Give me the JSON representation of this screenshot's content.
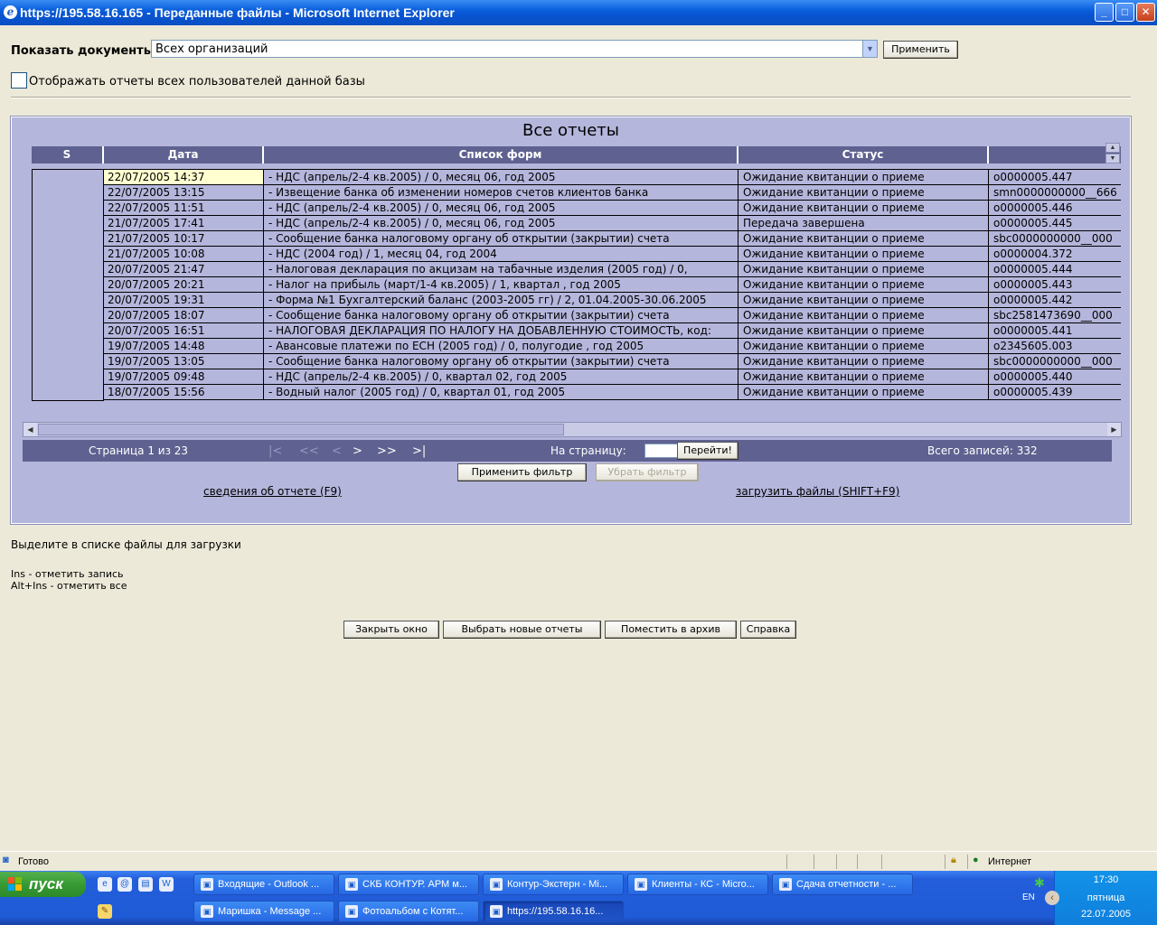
{
  "window": {
    "title": "https://195.58.16.165 - Переданные файлы - Microsoft Internet Explorer"
  },
  "filter": {
    "show_label": "Показать документы:",
    "org_value": "Всех организаций",
    "apply_label": "Применить",
    "all_users_label": "Отображать отчеты всех пользователей данной базы"
  },
  "panel": {
    "title": "Все отчеты",
    "columns": {
      "s": "S",
      "date": "Дата",
      "forms": "Список форм",
      "status": "Статус",
      "file": ""
    },
    "rows": [
      {
        "date": "22/07/2005 14:37",
        "form": "- НДС (апрель/2-4 кв.2005) / 0, месяц 06, год 2005",
        "status": "Ожидание квитанции о приеме",
        "file": "o0000005.447"
      },
      {
        "date": "22/07/2005 13:15",
        "form": "- Извещение банка об изменении номеров счетов клиентов банка",
        "status": "Ожидание квитанции о приеме",
        "file": "smn0000000000__666"
      },
      {
        "date": "22/07/2005 11:51",
        "form": "- НДС (апрель/2-4 кв.2005) / 0, месяц 06, год 2005",
        "status": "Ожидание квитанции о приеме",
        "file": "o0000005.446"
      },
      {
        "date": "21/07/2005 17:41",
        "form": "- НДС (апрель/2-4 кв.2005) / 0, месяц 06, год 2005",
        "status": "Передача завершена",
        "file": "o0000005.445"
      },
      {
        "date": "21/07/2005 10:17",
        "form": "- Сообщение банка налоговому органу об открытии (закрытии) счета",
        "status": "Ожидание квитанции о приеме",
        "file": "sbc0000000000__000"
      },
      {
        "date": "21/07/2005 10:08",
        "form": "- НДС (2004 год) / 1, месяц 04, год 2004",
        "status": "Ожидание квитанции о приеме",
        "file": "o0000004.372"
      },
      {
        "date": "20/07/2005 21:47",
        "form": "- Налоговая декларация по акцизам на табачные изделия (2005 год) / 0,",
        "status": "Ожидание квитанции о приеме",
        "file": "o0000005.444"
      },
      {
        "date": "20/07/2005 20:21",
        "form": "- Налог на прибыль (март/1-4 кв.2005) / 1, квартал , год 2005",
        "status": "Ожидание квитанции о приеме",
        "file": "o0000005.443"
      },
      {
        "date": "20/07/2005 19:31",
        "form": "- Форма №1 Бухгалтерский баланс (2003-2005 гг) / 2, 01.04.2005-30.06.2005",
        "status": "Ожидание квитанции о приеме",
        "file": "o0000005.442"
      },
      {
        "date": "20/07/2005 18:07",
        "form": "- Сообщение банка налоговому органу об открытии (закрытии) счета",
        "status": "Ожидание квитанции о приеме",
        "file": "sbc2581473690__000"
      },
      {
        "date": "20/07/2005 16:51",
        "form": "- НАЛОГОВАЯ ДЕКЛАРАЦИЯ ПО НАЛОГУ НА ДОБАВЛЕННУЮ СТОИМОСТЬ, код:",
        "status": "Ожидание квитанции о приеме",
        "file": "o0000005.441"
      },
      {
        "date": "19/07/2005 14:48",
        "form": "- Авансовые платежи по ЕСН (2005 год) / 0, полугодие , год 2005",
        "status": "Ожидание квитанции о приеме",
        "file": "o2345605.003"
      },
      {
        "date": "19/07/2005 13:05",
        "form": "- Сообщение банка налоговому органу об открытии (закрытии) счета",
        "status": "Ожидание квитанции о приеме",
        "file": "sbc0000000000__000"
      },
      {
        "date": "19/07/2005 09:48",
        "form": "- НДС (апрель/2-4 кв.2005) / 0, квартал 02, год 2005",
        "status": "Ожидание квитанции о приеме",
        "file": "o0000005.440"
      },
      {
        "date": "18/07/2005 15:56",
        "form": "- Водный налог (2005 год) / 0, квартал 01, год 2005",
        "status": "Ожидание квитанции о приеме",
        "file": "o0000005.439"
      }
    ],
    "pager": {
      "page_info": "Страница 1 из 23",
      "first": "|<",
      "prev_page": "<<",
      "prev": "<",
      "next": ">",
      "next_page": ">>",
      "last": ">|",
      "goto_label": "На страницу:",
      "goto_button": "Перейти!",
      "total": "Всего записей: 332"
    },
    "apply_filter": "Применить фильтр",
    "remove_filter": "Убрать фильтр",
    "report_info_link": "сведения об отчете (F9)",
    "download_link": "загрузить файлы (SHIFT+F9)"
  },
  "hints": {
    "select_files": "Выделите в списке файлы для загрузки",
    "ins": "Ins - отметить запись",
    "alt_ins": "Alt+Ins - отметить все"
  },
  "actions": {
    "close": "Закрыть окно",
    "select_new": "Выбрать новые отчеты",
    "archive": "Поместить в архив",
    "help": "Справка"
  },
  "statusbar": {
    "ready": "Готово",
    "zone": "Интернет"
  },
  "taskbar": {
    "start": "пуск",
    "tasks_row1": [
      "Входящие - Outlook ...",
      "СКБ КОНТУР. АРМ м...",
      "Контур-Экстерн - Mi...",
      "Клиенты - КС - Micro...",
      "Сдача отчетности - ..."
    ],
    "tasks_row2": [
      "Маришка - Message ...",
      "Фотоальбом с Котят...",
      "https://195.58.16.16..."
    ],
    "lang": "EN",
    "time": "17:30",
    "weekday": "пятница",
    "date": "22.07.2005"
  }
}
